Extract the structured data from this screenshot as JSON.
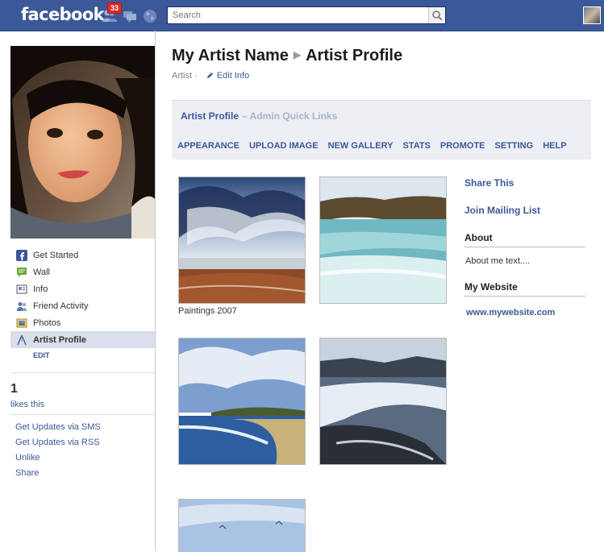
{
  "topbar": {
    "logo": "facebook",
    "friend_requests_count": "33",
    "search_placeholder": "Search"
  },
  "left": {
    "nav": [
      {
        "label": "Get Started",
        "icon": "facebook-icon"
      },
      {
        "label": "Wall",
        "icon": "wall-icon"
      },
      {
        "label": "Info",
        "icon": "info-icon"
      },
      {
        "label": "Friend Activity",
        "icon": "friends-icon"
      },
      {
        "label": "Photos",
        "icon": "photos-icon"
      },
      {
        "label": "Artist Profile",
        "icon": "artist-profile-icon",
        "active": true
      }
    ],
    "edit_label": "EDIT",
    "likes_count": "1",
    "likes_label": "likes this",
    "actions": [
      "Get Updates via SMS",
      "Get Updates via RSS",
      "Unlike",
      "Share"
    ]
  },
  "main": {
    "page_name": "My Artist Name",
    "tab_name": "Artist Profile",
    "category": "Artist ·",
    "edit_info": "Edit Info",
    "admin": {
      "title": "Artist Profile",
      "subtitle": "– Admin Quick Links",
      "links": [
        "APPEARANCE",
        "UPLOAD IMAGE",
        "NEW GALLERY",
        "STATS",
        "PROMOTE",
        "SETTING",
        "HELP"
      ]
    },
    "gallery_caption": "Paintings 2007",
    "sidebar": {
      "share": "Share This",
      "mailing": "Join Mailing List",
      "about_heading": "About",
      "about_text": "About me text....",
      "website_heading": "My Website",
      "website_url": "www.mywebsite.com"
    }
  },
  "colors": {
    "brand": "#3b5998",
    "admin_bg": "#edeff4",
    "badge": "#e02b2b"
  }
}
